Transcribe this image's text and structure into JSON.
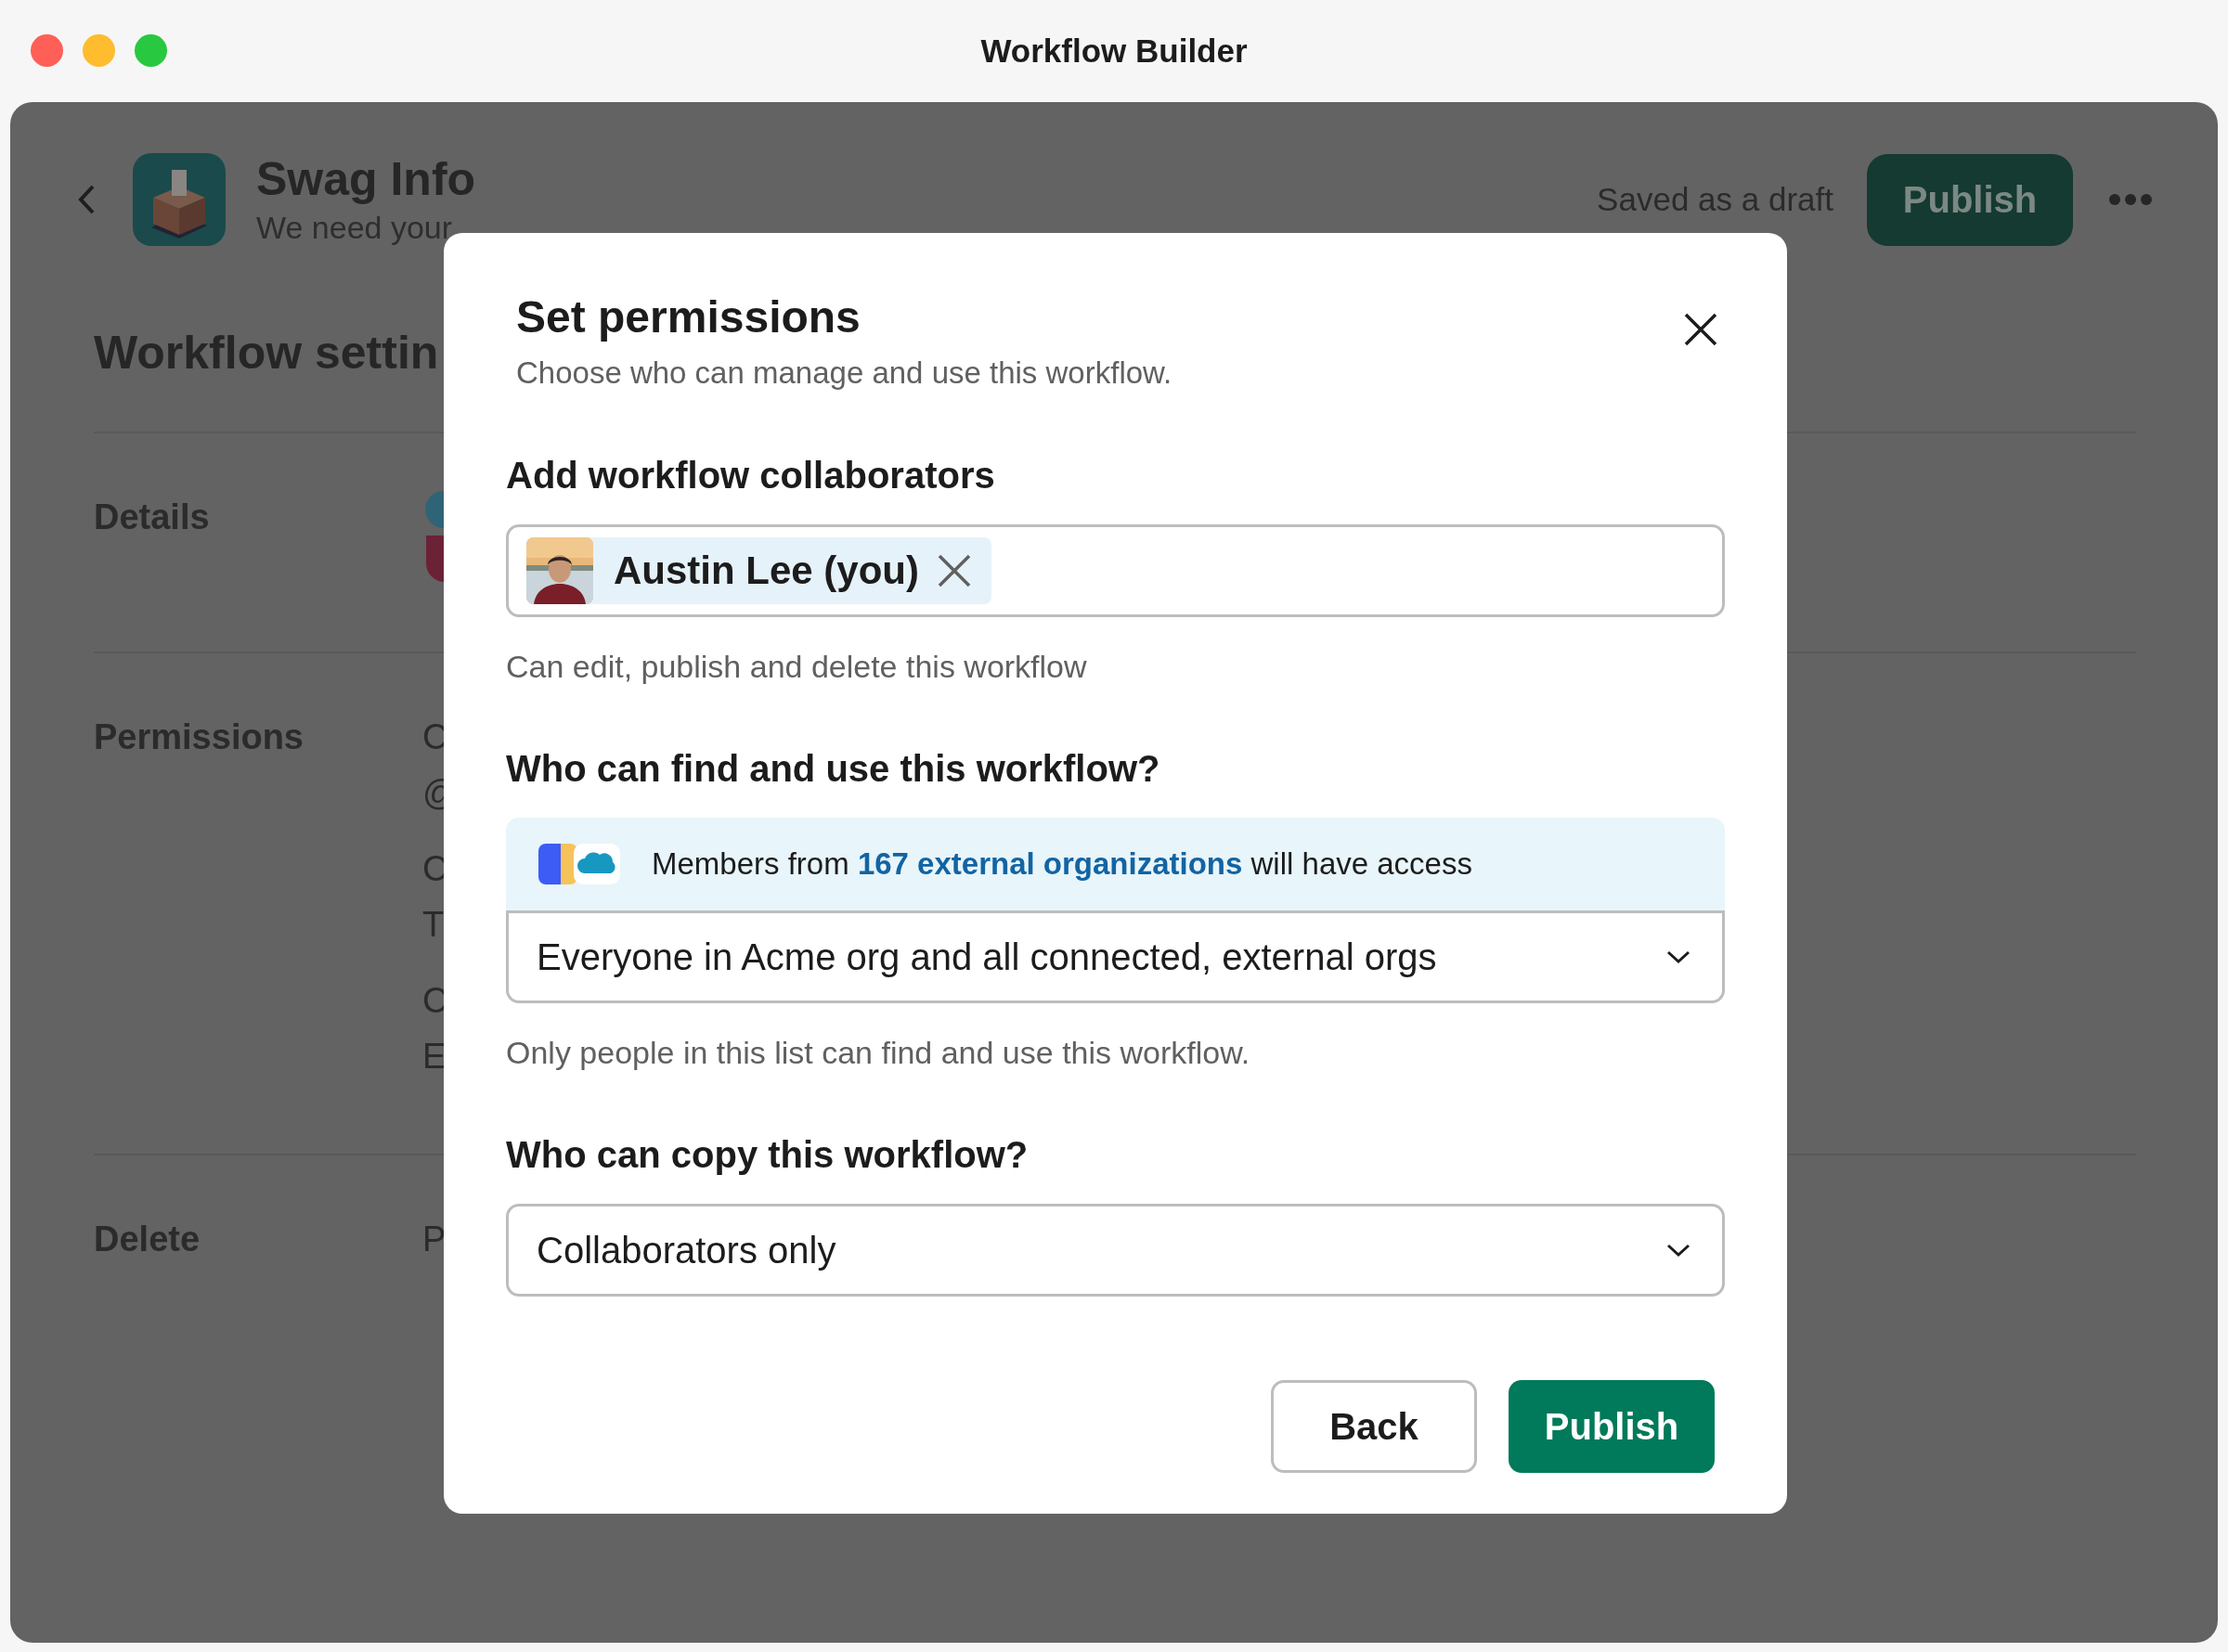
{
  "window": {
    "title": "Workflow Builder"
  },
  "header": {
    "title": "Swag Info",
    "subtitle": "We need your",
    "status": "Saved as a draft",
    "publish_button": "Publish"
  },
  "settings": {
    "title": "Workflow settin",
    "sections": [
      {
        "label": "Details",
        "kind": "icon"
      },
      {
        "label": "Permissions",
        "kind": "text",
        "groups": [
          [
            "C",
            "@"
          ],
          [
            "C",
            "T"
          ],
          [
            "C",
            "E"
          ]
        ]
      },
      {
        "label": "Delete",
        "kind": "text",
        "groups": [
          [
            "P"
          ]
        ]
      }
    ]
  },
  "dialog": {
    "title": "Set permissions",
    "subtitle": "Choose who can manage and use this workflow.",
    "collaborators": {
      "label": "Add workflow collaborators",
      "chips": [
        {
          "name": "Austin Lee (you)"
        }
      ],
      "hint": "Can edit, publish and delete this workflow"
    },
    "access": {
      "label": "Who can find and use this workflow?",
      "banner": {
        "prefix": "Members from",
        "link": "167 external organizations",
        "suffix": "will have access"
      },
      "value": "Everyone in Acme org and all connected, external orgs",
      "hint": "Only people in this list can find and use this workflow."
    },
    "copy": {
      "label": "Who can copy this workflow?",
      "value": "Collaborators only"
    },
    "buttons": [
      {
        "label": "Back",
        "kind": "secondary"
      },
      {
        "label": "Publish",
        "kind": "primary"
      }
    ]
  }
}
